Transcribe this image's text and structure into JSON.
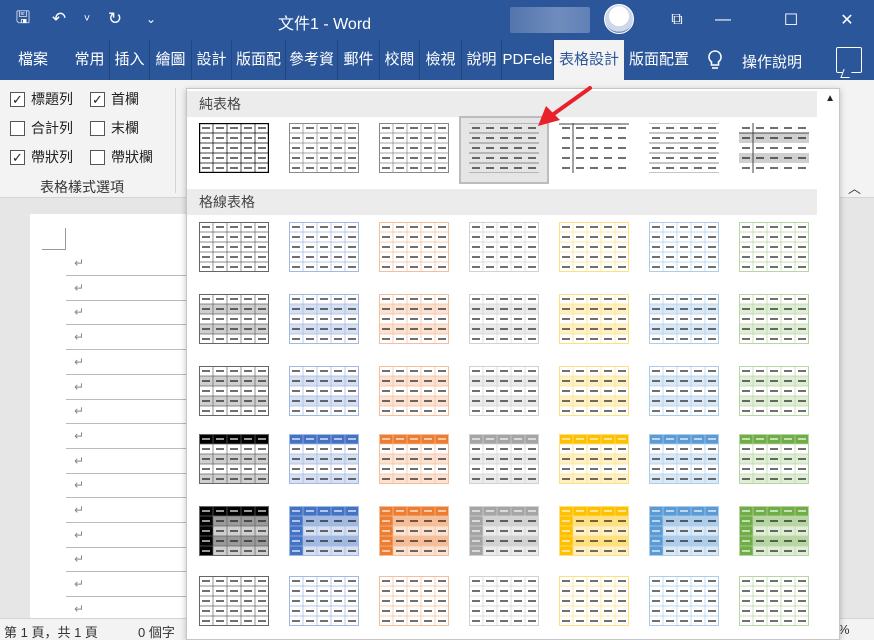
{
  "app": {
    "doc_title": "文件1 - Word",
    "qat": [
      {
        "name": "save-icon",
        "glyph": "🖫"
      },
      {
        "name": "undo-icon",
        "glyph": "↶"
      },
      {
        "name": "undo-dropdown-icon",
        "glyph": "˅"
      },
      {
        "name": "redo-icon",
        "glyph": "↻"
      },
      {
        "name": "customize-qat-icon",
        "glyph": "⌄"
      }
    ]
  },
  "window_buttons": {
    "restore_ribbon": "⧉",
    "minimize": "—",
    "maximize": "☐",
    "close": "✕"
  },
  "tabs": [
    "檔案",
    "常用",
    "插入",
    "繪圖",
    "設計",
    "版面配",
    "參考資",
    "郵件",
    "校閱",
    "檢視",
    "說明",
    "PDFele",
    "表格設計",
    "版面配置"
  ],
  "active_tab": "表格設計",
  "help": {
    "label": "操作說明",
    "icon": "lightbulb-icon"
  },
  "table_style_options": {
    "group_label": "表格樣式選項",
    "options": [
      {
        "label": "標題列",
        "checked": true
      },
      {
        "label": "首欄",
        "checked": true
      },
      {
        "label": "合計列",
        "checked": false
      },
      {
        "label": "末欄",
        "checked": false
      },
      {
        "label": "帶狀列",
        "checked": true
      },
      {
        "label": "帶狀欄",
        "checked": false
      }
    ]
  },
  "gallery": {
    "sections": [
      "純表格",
      "格線表格"
    ],
    "accent_colors": [
      "#000000",
      "#4472c4",
      "#ed7d31",
      "#a5a5a5",
      "#ffc000",
      "#5b9bd5",
      "#70ad47"
    ],
    "selected_style_index": 3,
    "selection_arrow_color": "#e8212b"
  },
  "document": {
    "paragraph_mark": "↵"
  },
  "status": {
    "page": "第 1 頁，共 1 頁",
    "words": "0 個字",
    "zoom": "%"
  }
}
